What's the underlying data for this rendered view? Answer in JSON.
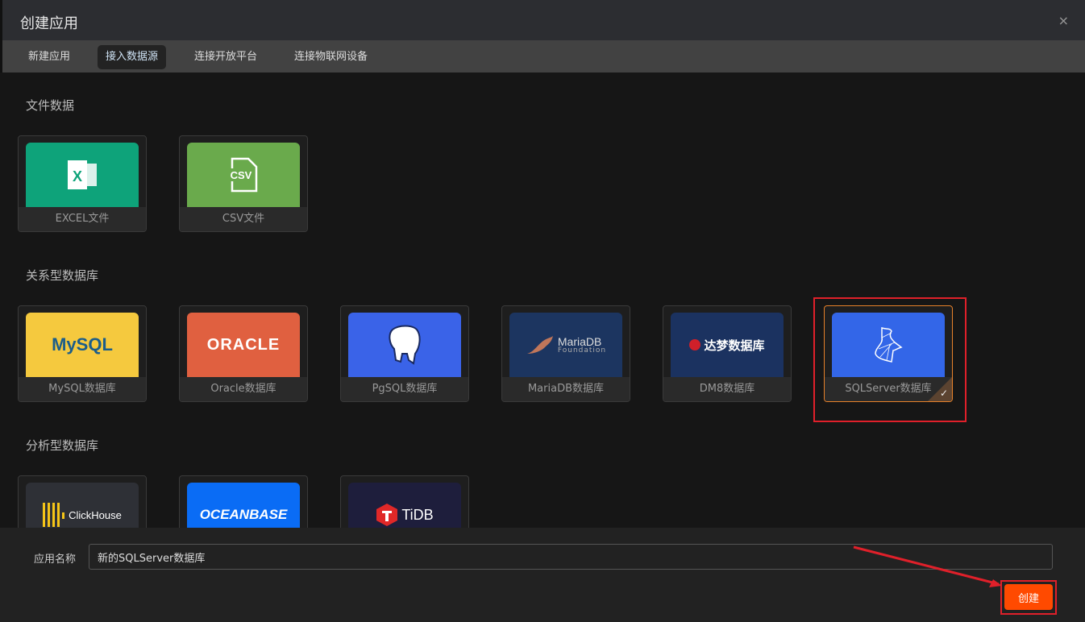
{
  "dialog": {
    "title": "创建应用",
    "close": "×"
  },
  "tabs": [
    {
      "label": "新建应用"
    },
    {
      "label": "接入数据源"
    },
    {
      "label": "连接开放平台"
    },
    {
      "label": "连接物联网设备"
    }
  ],
  "sections": {
    "file": {
      "title": "文件数据",
      "items": [
        {
          "label": "EXCEL文件",
          "logo": "X",
          "color": "#0ea37a"
        },
        {
          "label": "CSV文件",
          "logo": "CSV",
          "color": "#6aaa4c"
        }
      ]
    },
    "relational": {
      "title": "关系型数据库",
      "items": [
        {
          "label": "MySQL数据库",
          "logo": "MySQL",
          "color": "#f5c93e"
        },
        {
          "label": "Oracle数据库",
          "logo": "ORACLE",
          "color": "#e06040"
        },
        {
          "label": "PgSQL数据库",
          "logo": "elephant",
          "color": "#3a63e8"
        },
        {
          "label": "MariaDB数据库",
          "logo": "MariaDB",
          "logo_sub": "Foundation",
          "color": "#1c3560"
        },
        {
          "label": "DM8数据库",
          "logo": "达梦数据库",
          "color": "#1b3260"
        },
        {
          "label": "SQLServer数据库",
          "logo": "sqlserver",
          "color": "#3366e8",
          "selected": true
        }
      ]
    },
    "analytic": {
      "title": "分析型数据库",
      "items": [
        {
          "label": "ClickHouse",
          "logo": "ClickHouse",
          "color": "#2e3036"
        },
        {
          "label": "OceanBase",
          "logo": "OCEANBASE",
          "color": "#0a6cf5"
        },
        {
          "label": "TiDB",
          "logo": "TiDB",
          "color": "#1e1e3c"
        }
      ]
    }
  },
  "footer": {
    "name_label": "应用名称",
    "name_value": "新的SQLServer数据库",
    "create": "创建"
  }
}
